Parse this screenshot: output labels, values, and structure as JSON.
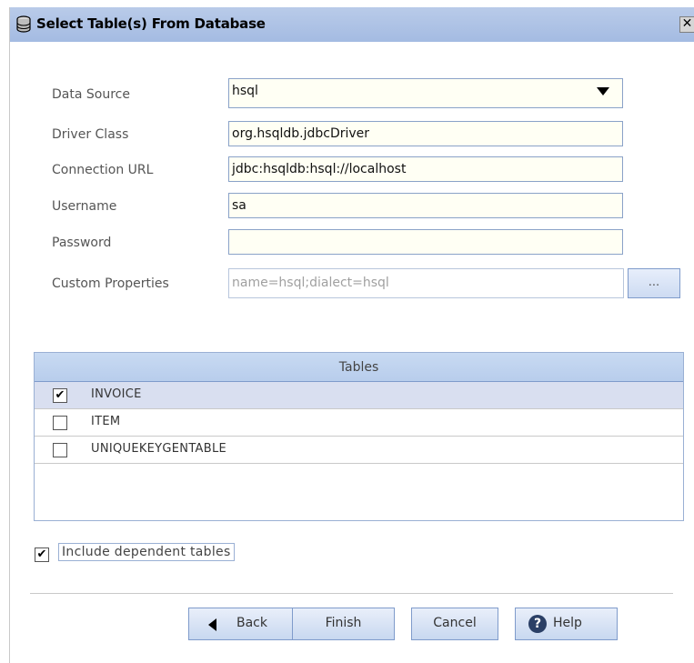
{
  "window": {
    "title": "Select Table(s) From Database",
    "close_glyph": "✕"
  },
  "form": {
    "data_source": {
      "label": "Data Source",
      "value": "hsql"
    },
    "driver_class": {
      "label": "Driver Class",
      "value": "org.hsqldb.jdbcDriver"
    },
    "connection_url": {
      "label": "Connection URL",
      "value": "jdbc:hsqldb:hsql://localhost"
    },
    "username": {
      "label": "Username",
      "value": "sa"
    },
    "password": {
      "label": "Password",
      "value": ""
    },
    "custom_properties": {
      "label": "Custom Properties",
      "value": "name=hsql;dialect=hsql",
      "button_label": "..."
    }
  },
  "tables": {
    "header": "Tables",
    "rows": [
      {
        "name": "INVOICE",
        "checked": true,
        "selected": true
      },
      {
        "name": "ITEM",
        "checked": false,
        "selected": false
      },
      {
        "name": "UNIQUEKEYGENTABLE",
        "checked": false,
        "selected": false
      }
    ]
  },
  "include_dependent": {
    "label": "Include dependent tables",
    "checked": true
  },
  "buttons": {
    "back": "Back",
    "finish": "Finish",
    "cancel": "Cancel",
    "help": "Help"
  },
  "colors": {
    "titlebar": "#a4bbe2",
    "field_bg": "#fffff4",
    "accent_border": "#7f9bcb",
    "selected_row": "#d9dff0"
  }
}
